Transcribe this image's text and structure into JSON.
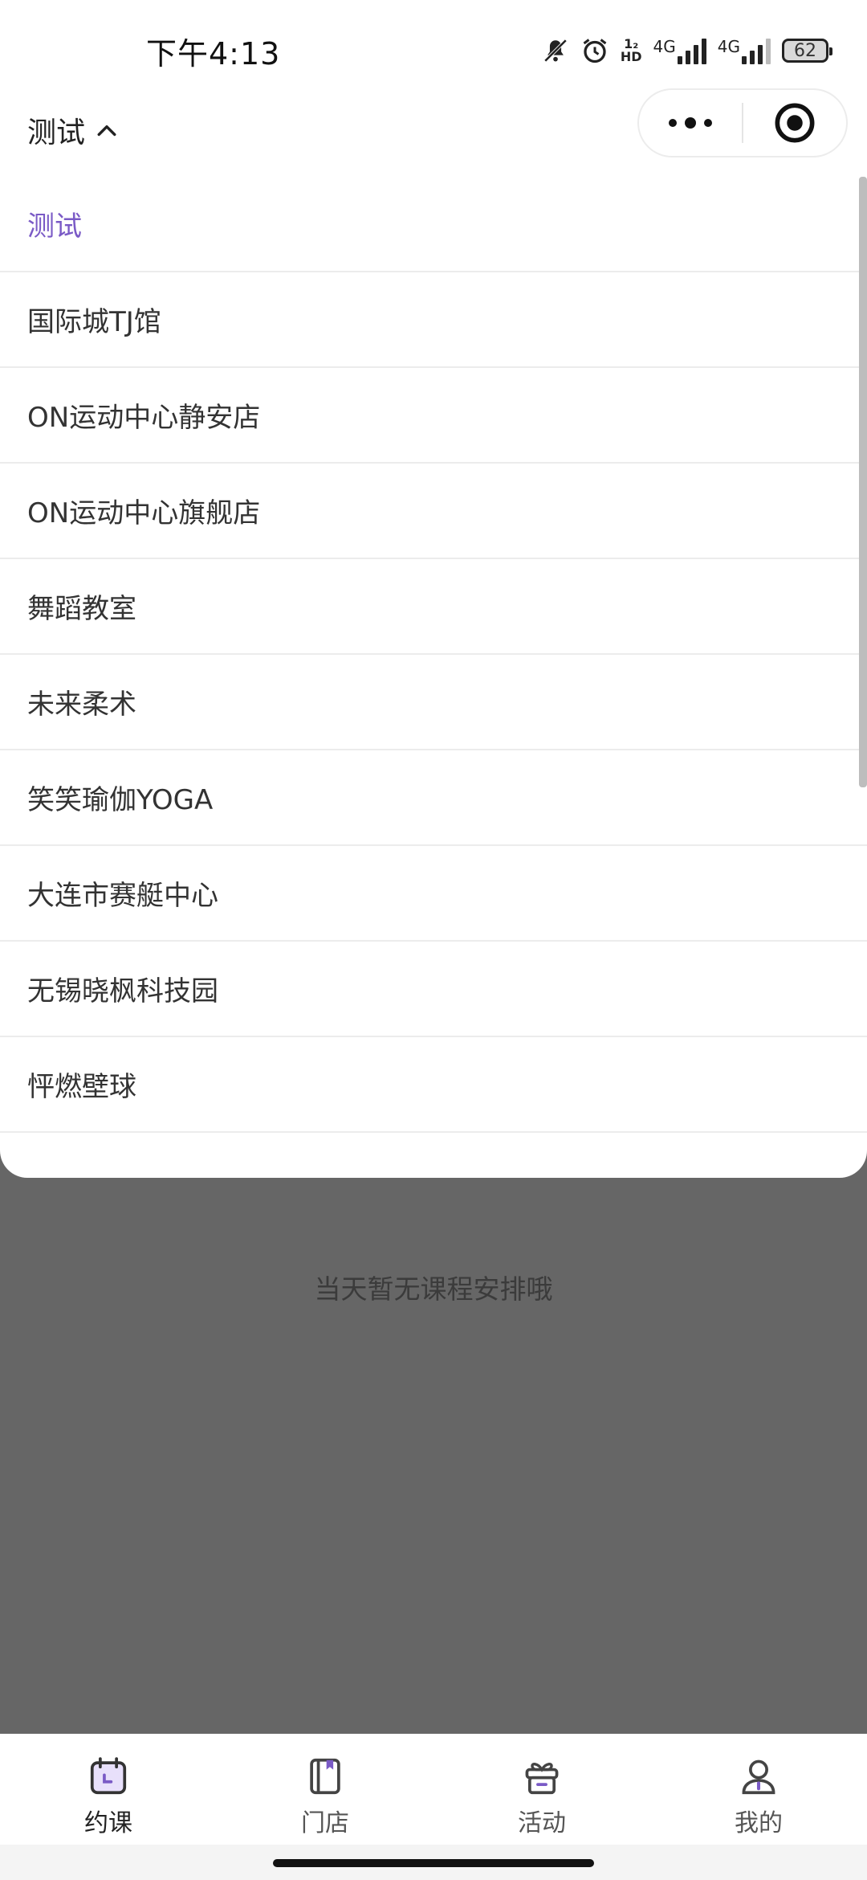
{
  "status_bar": {
    "time": "下午4:13",
    "signal_label_1": "4G",
    "signal_label_2": "4G",
    "battery": "62",
    "icons": [
      "bell-off-icon",
      "alarm-icon",
      "hd-icon",
      "signal-icon",
      "signal-icon",
      "battery-icon"
    ]
  },
  "header": {
    "store_name": "测试",
    "menu_icon": "more-dots-icon",
    "close_icon": "target-close-icon"
  },
  "dropdown": {
    "items": [
      {
        "label": "测试",
        "active": true
      },
      {
        "label": "国际城TJ馆",
        "active": false
      },
      {
        "label": "ON运动中心静安店",
        "active": false
      },
      {
        "label": "ON运动中心旗舰店",
        "active": false
      },
      {
        "label": "舞蹈教室",
        "active": false
      },
      {
        "label": "未来柔术",
        "active": false
      },
      {
        "label": "笑笑瑜伽YOGA",
        "active": false
      },
      {
        "label": "大连市赛艇中心",
        "active": false
      },
      {
        "label": "无锡晓枫科技园",
        "active": false
      },
      {
        "label": "怦燃壁球",
        "active": false
      }
    ]
  },
  "main": {
    "empty_text": "当天暂无课程安排哦"
  },
  "tabbar": {
    "tabs": [
      {
        "label": "约课",
        "icon": "calendar-icon",
        "active": true
      },
      {
        "label": "门店",
        "icon": "book-icon",
        "active": false
      },
      {
        "label": "活动",
        "icon": "gift-icon",
        "active": false
      },
      {
        "label": "我的",
        "icon": "user-icon",
        "active": false
      }
    ]
  },
  "colors": {
    "accent": "#7a5ac6",
    "overlay": "#666666"
  }
}
